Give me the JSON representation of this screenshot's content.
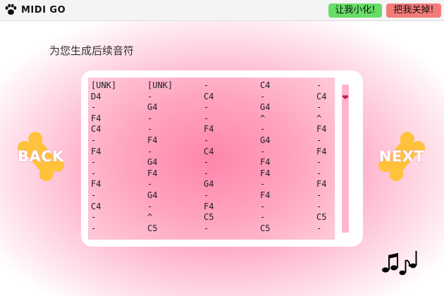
{
  "window": {
    "title": "MIDI GO",
    "minimize_label": "让我小化!",
    "close_label": "把我关掉!"
  },
  "main": {
    "subtitle": "为您生成后续音符"
  },
  "nav": {
    "back_label": "BACK",
    "next_label": "NEXT"
  },
  "notes_grid": [
    [
      "[UNK]",
      "[UNK]",
      "-",
      "C4",
      "-"
    ],
    [
      "D4",
      "-",
      "C4",
      "-",
      "C4"
    ],
    [
      "-",
      "G4",
      "-",
      "G4",
      "-"
    ],
    [
      "F4",
      "-",
      "-",
      "^",
      "^"
    ],
    [
      "C4",
      "-",
      "F4",
      "-",
      "F4"
    ],
    [
      "-",
      "F4",
      "-",
      "G4",
      "-"
    ],
    [
      "F4",
      "-",
      "C4",
      "-",
      "F4"
    ],
    [
      "-",
      "G4",
      "-",
      "F4",
      "-"
    ],
    [
      "-",
      "F4",
      "-",
      "F4",
      "-"
    ],
    [
      "F4",
      "-",
      "G4",
      "-",
      "F4"
    ],
    [
      "-",
      "G4",
      "-",
      "F4",
      "-"
    ],
    [
      "C4",
      "-",
      "F4",
      "-",
      "-"
    ],
    [
      "-",
      "^",
      "C5",
      "-",
      "C5"
    ],
    [
      "-",
      "C5",
      "-",
      "C5",
      "-"
    ]
  ],
  "icons": {
    "window_icon": "paw-icon",
    "scroll_thumb": "heart-icon",
    "decoration": "music-notes-icon",
    "nav_background": "bone-icon"
  },
  "colors": {
    "minimize_button": "#66dd66",
    "close_button": "#f47a7a",
    "accent_pink": "#ff7aa2",
    "bone": "#ffc23a"
  }
}
